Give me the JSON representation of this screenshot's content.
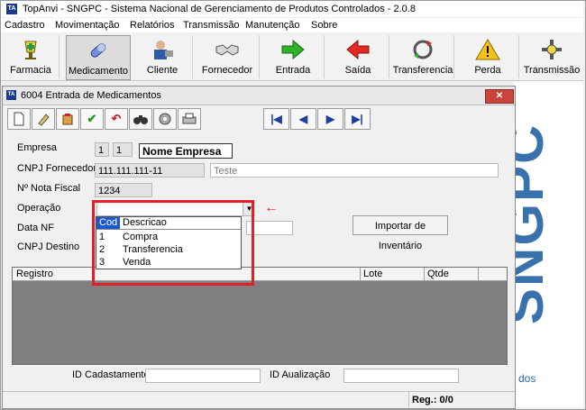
{
  "app": {
    "title": "TopAnvi - SNGPC - Sistema Nacional de Gerenciamento de Produtos Controlados - 2.0.8",
    "icon_text": "TA"
  },
  "menu": [
    "Cadastro",
    "Movimentação",
    "Relatórios",
    "Transmissão",
    "Manutenção",
    "Sobre"
  ],
  "toolbar": [
    "Farmacia",
    "Medicamento",
    "Cliente",
    "Fornecedor",
    "Entrada",
    "Saída",
    "Transferencia",
    "Perda",
    "Transmissão"
  ],
  "background": {
    "logo": "SNGPC",
    "trailing_text": "dos"
  },
  "window": {
    "title": "6004 Entrada de Medicamentos",
    "icon_text": "TA",
    "close_label": "✕"
  },
  "child_toolbar": {
    "icons": [
      "new-document-icon",
      "edit-icon",
      "delete-icon",
      "confirm-check-icon",
      "undo-icon",
      "search-binoculars-icon",
      "tape-icon",
      "print-icon"
    ],
    "nav": [
      "|◀",
      "◀",
      "▶",
      "▶|"
    ]
  },
  "form": {
    "empresa_label": "Empresa",
    "empresa_code1": "1",
    "empresa_code2": "1",
    "empresa_name": "Nome Empresa",
    "cnpj_fornecedor_label": "CNPJ Fornecedor",
    "cnpj_fornecedor_value": "111.111.111-11",
    "fornecedor_name": "Teste",
    "nota_fiscal_label": "Nº Nota Fiscal",
    "nota_fiscal_value": "1234",
    "operacao_label": "Operação",
    "operacao_value": "",
    "data_nf_label": "Data NF",
    "cnpj_destino_label": "CNPJ Destino",
    "importar_label": "Importar de Inventário"
  },
  "operation_dropdown": {
    "headers": [
      "Cod",
      "Descricao"
    ],
    "options": [
      {
        "cod": "1",
        "descricao": "Compra"
      },
      {
        "cod": "2",
        "descricao": "Transferencia"
      },
      {
        "cod": "3",
        "descricao": "Venda"
      }
    ]
  },
  "grid": {
    "columns": [
      "Registro",
      "Lote",
      "Qtde"
    ]
  },
  "footer": {
    "id_cadastamento_label": "ID Cadastamento",
    "id_atualizacao_label": "ID Aualização",
    "reg_label": "Reg.: 0/0"
  },
  "colors": {
    "annotation": "#e2202a",
    "logo": "#2e6aa8"
  }
}
